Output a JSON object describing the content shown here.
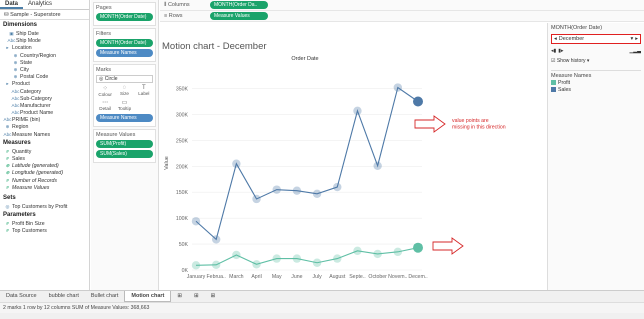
{
  "data_pane": {
    "tabs": [
      "Data",
      "Analytics"
    ],
    "source": "Sample - Superstore",
    "dimensions_title": "Dimensions",
    "dimensions": [
      {
        "icon": "▣",
        "label": "Ship Date",
        "indent": 1
      },
      {
        "icon": "Abc",
        "label": "Ship Mode",
        "indent": 1
      },
      {
        "icon": "▸",
        "label": "Location",
        "indent": 0
      },
      {
        "icon": "⊕",
        "label": "Country/Region",
        "indent": 2
      },
      {
        "icon": "⊕",
        "label": "State",
        "indent": 2
      },
      {
        "icon": "⊕",
        "label": "City",
        "indent": 2
      },
      {
        "icon": "⊕",
        "label": "Postal Code",
        "indent": 2
      },
      {
        "icon": "▸",
        "label": "Product",
        "indent": 0
      },
      {
        "icon": "Abc",
        "label": "Category",
        "indent": 2
      },
      {
        "icon": "Abc",
        "label": "Sub-Category",
        "indent": 2
      },
      {
        "icon": "Abc",
        "label": "Manufacturer",
        "indent": 2
      },
      {
        "icon": "Abc",
        "label": "Product Name",
        "indent": 2
      },
      {
        "icon": "Abc",
        "label": "PRIME (bin)",
        "indent": 0
      },
      {
        "icon": "⊕",
        "label": "Region",
        "indent": 0
      },
      {
        "icon": "Abc",
        "label": "Measure Names",
        "indent": 0
      }
    ],
    "measures_title": "Measures",
    "measures": [
      {
        "icon": "#",
        "label": "Quantity",
        "italic": false
      },
      {
        "icon": "#",
        "label": "Sales",
        "italic": false
      },
      {
        "icon": "⊕",
        "label": "Latitude (generated)",
        "italic": true
      },
      {
        "icon": "⊕",
        "label": "Longitude (generated)",
        "italic": true
      },
      {
        "icon": "#",
        "label": "Number of Records",
        "italic": true
      },
      {
        "icon": "#",
        "label": "Measure Values",
        "italic": true
      }
    ],
    "sets_title": "Sets",
    "sets": [
      {
        "icon": "◎",
        "label": "Top Customers by Profit"
      }
    ],
    "params_title": "Parameters",
    "params": [
      {
        "icon": "#",
        "label": "Profit Bin Size"
      },
      {
        "icon": "#",
        "label": "Top Customers"
      }
    ]
  },
  "middle_pane": {
    "pages_title": "Pages",
    "pages_pill": "MONTH(Order Date)",
    "filters_title": "Filters",
    "filters": [
      "MONTH(Order Date)",
      "Measure Names"
    ],
    "marks_title": "Marks",
    "marks_type": "◎ Circle",
    "marks_buttons": [
      {
        "icon": "⁘",
        "label": "Colour"
      },
      {
        "icon": "◌",
        "label": "Size"
      },
      {
        "icon": "T",
        "label": "Label"
      },
      {
        "icon": "⋯",
        "label": "Detail"
      },
      {
        "icon": "▭",
        "label": "Tooltip"
      }
    ],
    "marks_pill": "Measure Names",
    "mv_title": "Measure Values",
    "mv_pills": [
      "SUM(Profit)",
      "SUM(Sales)"
    ]
  },
  "shelves": {
    "columns_label": "Columns",
    "columns_pill": "MONTH(Order Da..",
    "rows_label": "Rows",
    "rows_pill": "Measure Values"
  },
  "view": {
    "title": "Motion chart - December",
    "annotation": "value points are\nmissing in this direction"
  },
  "right_pane": {
    "page_title": "MONTH(Order Date)",
    "page_value": "December",
    "show_history": "Show history ▾",
    "legend_title": "Measure Names",
    "legend": [
      {
        "label": "Profit",
        "color": "#5fbfa5"
      },
      {
        "label": "Sales",
        "color": "#4e79a7"
      }
    ]
  },
  "bottom": {
    "tabs": [
      "Data Source",
      "bubble chart",
      "Bullet chart",
      "Motion chart"
    ],
    "active_tab": "Motion chart",
    "status": "2 marks   1 row by 12 columns   SUM of Measure Values: 368,663"
  },
  "chart_data": {
    "type": "line",
    "title": "Order Date",
    "ylabel": "Value",
    "categories": [
      "January",
      "Februa..",
      "March",
      "April",
      "May",
      "June",
      "July",
      "August",
      "Septe..",
      "October",
      "Novem..",
      "Decem.."
    ],
    "ylim": [
      0,
      380000
    ],
    "yticks": [
      0,
      50000,
      100000,
      150000,
      200000,
      250000,
      300000,
      350000
    ],
    "ytick_labels": [
      "0K",
      "50K",
      "100K",
      "150K",
      "200K",
      "250K",
      "300K",
      "350K"
    ],
    "series": [
      {
        "name": "Sales",
        "color": "#4e79a7",
        "values": [
          94000,
          59000,
          205000,
          137000,
          155000,
          153000,
          147000,
          160000,
          307000,
          201000,
          352000,
          325000
        ]
      },
      {
        "name": "Profit",
        "color": "#5fbfa5",
        "values": [
          9000,
          10000,
          29000,
          11000,
          22000,
          22000,
          14000,
          22000,
          37000,
          31000,
          35000,
          43000
        ]
      }
    ]
  }
}
